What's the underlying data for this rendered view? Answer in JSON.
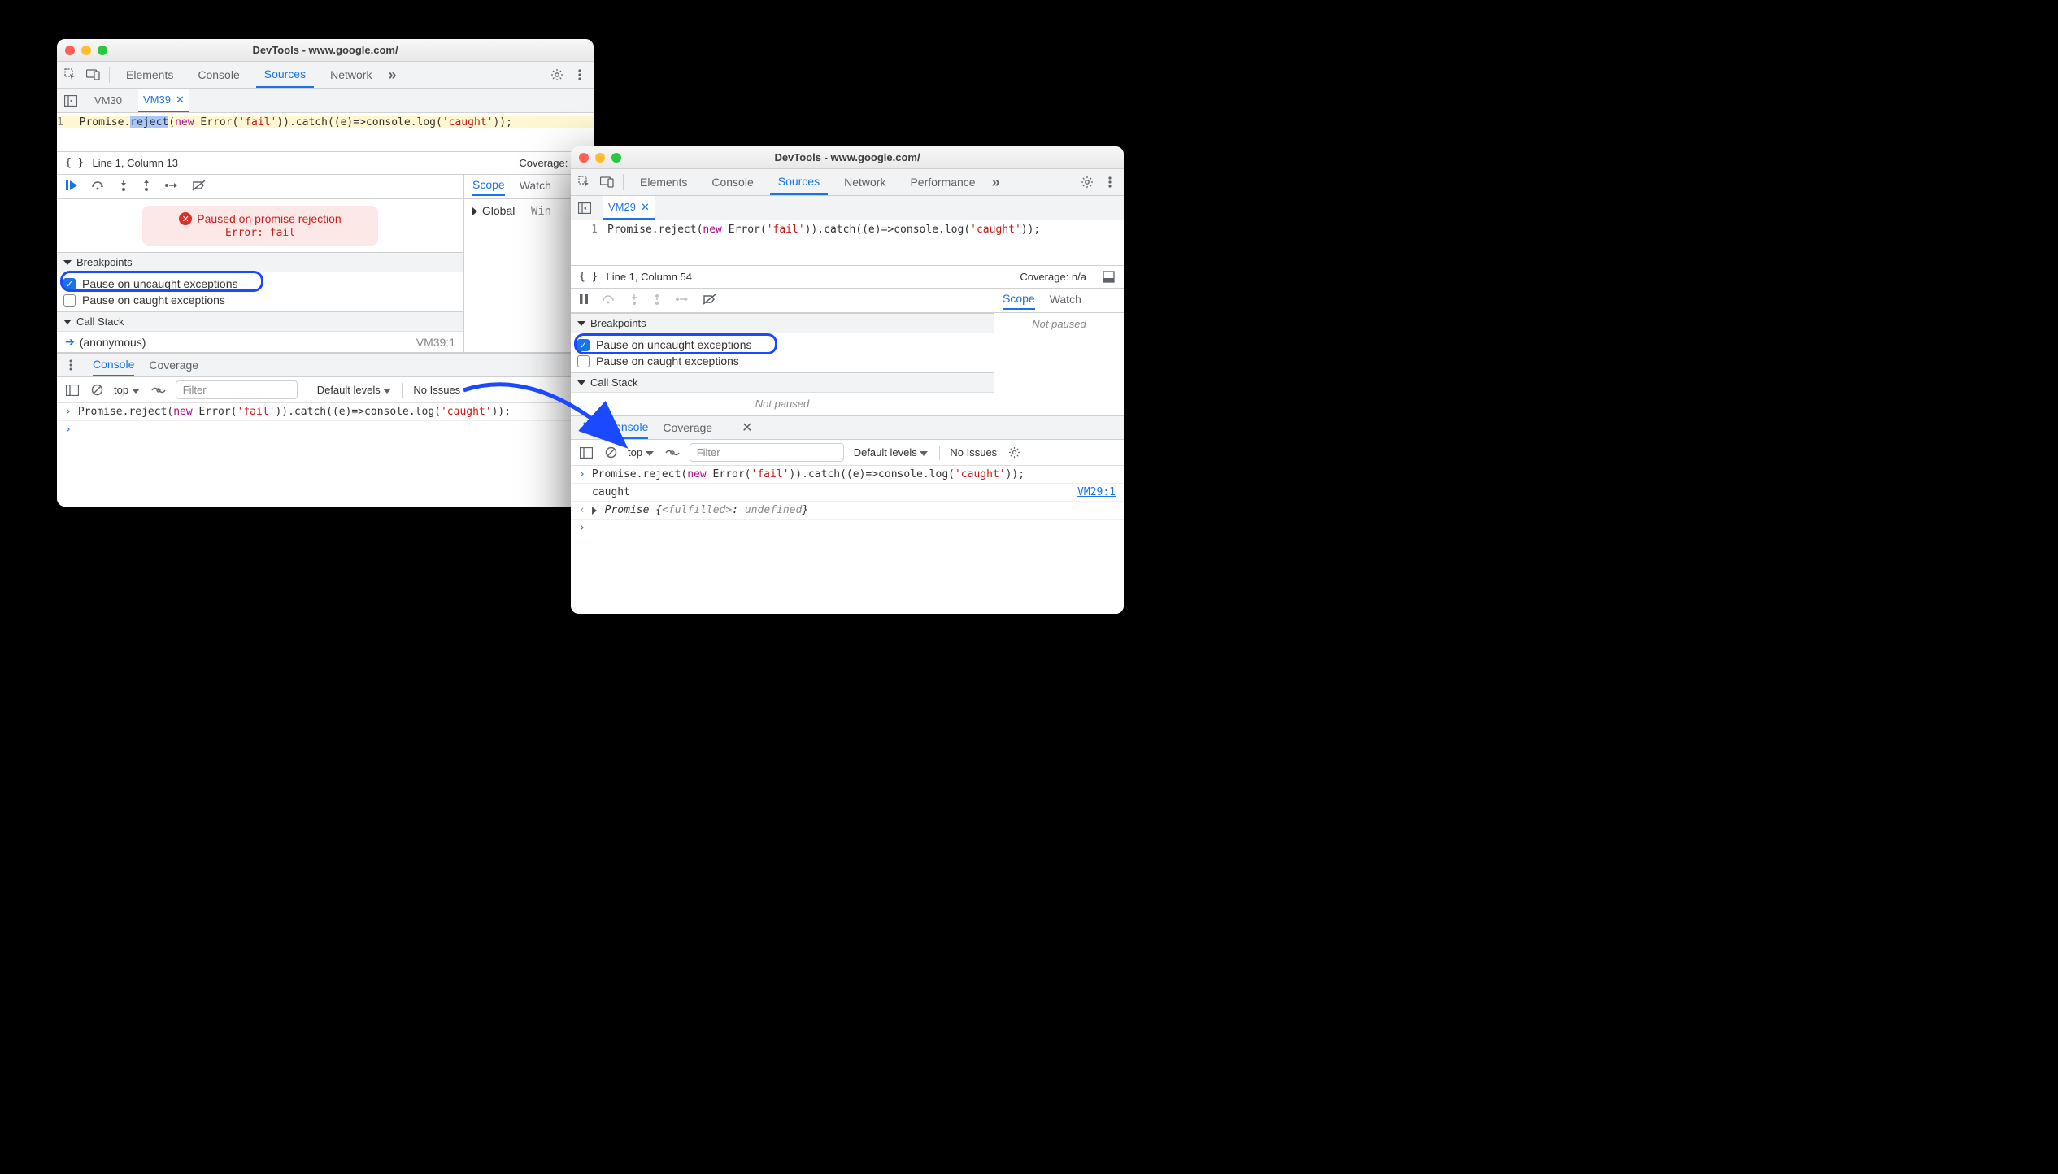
{
  "left": {
    "title": "DevTools - www.google.com/",
    "tabs": [
      "Elements",
      "Console",
      "Sources",
      "Network"
    ],
    "active_tab": "Sources",
    "file_tabs": {
      "inactive": "VM30",
      "active": "VM39"
    },
    "code": {
      "line_no": "1",
      "prefix": "Promise.",
      "selected": "reject",
      "rest1": "(",
      "kw": "new",
      "rest2": " Error(",
      "str1": "'fail'",
      "rest3": ")).catch((e)=>console.log(",
      "str2": "'caught'",
      "rest4": "));"
    },
    "status": {
      "position": "Line 1, Column 13",
      "coverage": "Coverage: n/a"
    },
    "paused": {
      "line1": "Paused on promise rejection",
      "line2": "Error: fail"
    },
    "scope": {
      "tab1": "Scope",
      "tab2": "Watch",
      "row": {
        "label": "Global",
        "value": "Win"
      }
    },
    "breakpoints": {
      "header": "Breakpoints",
      "uncaught": "Pause on uncaught exceptions",
      "caught": "Pause on caught exceptions"
    },
    "callstack": {
      "header": "Call Stack",
      "frame": "(anonymous)",
      "loc": "VM39:1"
    },
    "drawer": {
      "tab1": "Console",
      "tab2": "Coverage"
    },
    "console_toolbar": {
      "context": "top",
      "filter": "Filter",
      "levels": "Default levels",
      "issues": "No Issues"
    },
    "console": {
      "prefix": "Promise.reject(",
      "kw": "new",
      "rest1": " Error(",
      "str1": "'fail'",
      "rest2": ")).catch((e)=>console.log(",
      "str2": "'caught'",
      "rest3": "));"
    }
  },
  "right": {
    "title": "DevTools - www.google.com/",
    "tabs": [
      "Elements",
      "Console",
      "Sources",
      "Network",
      "Performance"
    ],
    "active_tab": "Sources",
    "file_tabs": {
      "active": "VM29"
    },
    "code": {
      "line_no": "1",
      "prefix": "Promise.reject(",
      "kw": "new",
      "rest1": " Error(",
      "str1": "'fail'",
      "rest2": ")).catch((e)=>console.log(",
      "str2": "'caught'",
      "rest3": "));"
    },
    "status": {
      "position": "Line 1, Column 54",
      "coverage": "Coverage: n/a"
    },
    "scope": {
      "tab1": "Scope",
      "tab2": "Watch",
      "not_paused": "Not paused"
    },
    "breakpoints": {
      "header": "Breakpoints",
      "uncaught": "Pause on uncaught exceptions",
      "caught": "Pause on caught exceptions"
    },
    "callstack": {
      "header": "Call Stack",
      "not_paused": "Not paused"
    },
    "drawer": {
      "tab1": "Console",
      "tab2": "Coverage"
    },
    "console_toolbar": {
      "context": "top",
      "filter": "Filter",
      "levels": "Default levels",
      "issues": "No Issues"
    },
    "console": {
      "input_prefix": "Promise.reject(",
      "kw": "new",
      "rest1": " Error(",
      "str1": "'fail'",
      "rest2": ")).catch((e)=>console.log(",
      "str2": "'caught'",
      "rest3": "));",
      "log": "caught",
      "log_loc": "VM29:1",
      "result_prefix": "Promise {",
      "result_state": "<fulfilled>",
      "result_sep": ": ",
      "result_val": "undefined",
      "result_suffix": "}"
    }
  }
}
